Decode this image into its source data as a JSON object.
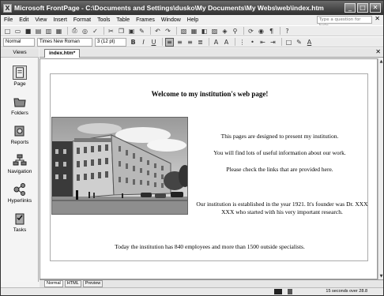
{
  "window": {
    "title": "Microsoft FrontPage - C:\\Documents and Settings\\dusko\\My Documents\\My Webs\\web\\index.htm",
    "app_icon": "frontpage-icon"
  },
  "menu": [
    "File",
    "Edit",
    "View",
    "Insert",
    "Format",
    "Tools",
    "Table",
    "Frames",
    "Window",
    "Help"
  ],
  "help_box_placeholder": "Type a question for help",
  "toolbar": {
    "style_select": "Normal",
    "font_select": "Times New Roman",
    "size_select": "3 (12 pt)"
  },
  "views": {
    "header": "Views",
    "items": [
      {
        "label": "Page",
        "icon": "page-icon"
      },
      {
        "label": "Folders",
        "icon": "folders-icon"
      },
      {
        "label": "Reports",
        "icon": "reports-icon"
      },
      {
        "label": "Navigation",
        "icon": "navigation-icon"
      },
      {
        "label": "Hyperlinks",
        "icon": "hyperlinks-icon"
      },
      {
        "label": "Tasks",
        "icon": "tasks-icon"
      }
    ]
  },
  "doc_tab": "index.htm*",
  "page": {
    "heading": "Welcome to my institution's web page!",
    "p1": "This pages are designed to present my institution.",
    "p2": "You will find lots of useful information about our work.",
    "p3": "Please check the links that are provided here.",
    "p4": "Our institution is established in the year 1921. It's founder was Dr. XXX XXX who started with his very important research.",
    "p5": "Today the institution has 840 employees and more than 1500 outside specialists."
  },
  "view_tabs": [
    "Normal",
    "HTML",
    "Preview"
  ],
  "status": "15 seconds over 28.8"
}
